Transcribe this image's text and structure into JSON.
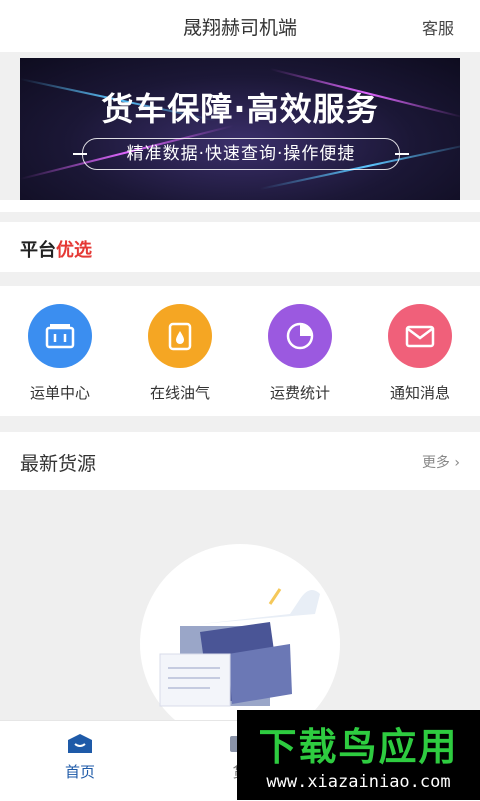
{
  "header": {
    "title": "晟翔赫司机端",
    "service_label": "客服"
  },
  "banner": {
    "title": "货车保障·高效服务",
    "subtitle": "精准数据·快速查询·操作便捷"
  },
  "platform_pick": {
    "label_a": "平台",
    "label_b": "优选",
    "accent_color": "#e53935"
  },
  "quick_entries": [
    {
      "label": "运单中心",
      "icon": "waybill-icon",
      "color": "#3b8ef0"
    },
    {
      "label": "在线油气",
      "icon": "fuel-icon",
      "color": "#f5a623"
    },
    {
      "label": "运费统计",
      "icon": "chart-icon",
      "color": "#9b59e0"
    },
    {
      "label": "通知消息",
      "icon": "mail-icon",
      "color": "#f0607a"
    }
  ],
  "latest": {
    "title": "最新货源",
    "more_label": "更多 ›"
  },
  "tabbar": {
    "home_label": "首页",
    "goods_label": "货",
    "active_color": "#1e5aa8"
  },
  "watermark": {
    "big_text": "下载鸟应用",
    "url": "www.xiazainiao.com"
  }
}
